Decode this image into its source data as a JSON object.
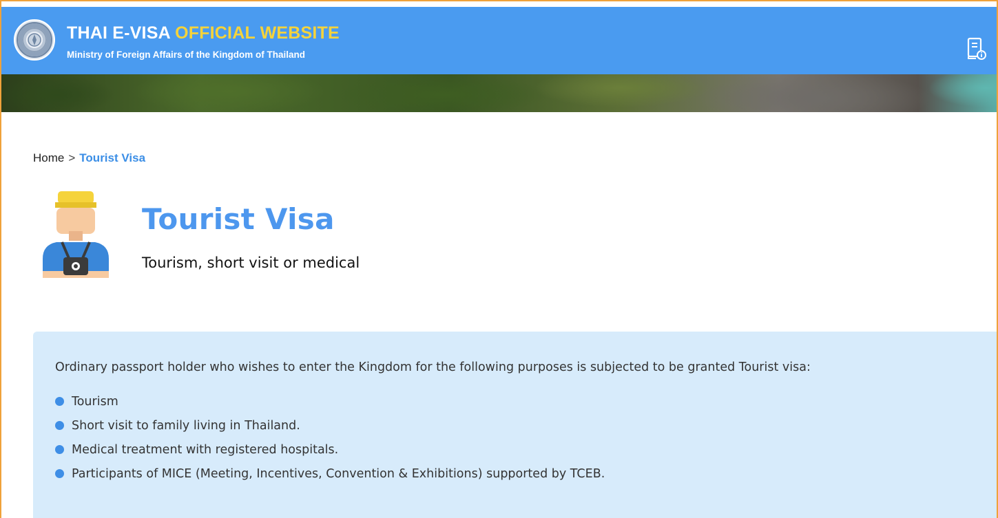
{
  "header": {
    "title_main": "THAI E-VISA",
    "title_accent": "OFFICIAL WEBSITE",
    "subtitle": "Ministry of Foreign Affairs of the Kingdom of Thailand",
    "brand_color": "#4a9bf0",
    "accent_color": "#f5d33b",
    "logo_icon": "government-seal-icon",
    "action_icon": "document-info-icon"
  },
  "breadcrumb": {
    "home": "Home",
    "separator": ">",
    "current": "Tourist Visa"
  },
  "page": {
    "icon": "tourist-avatar-icon",
    "title": "Tourist Visa",
    "subtitle": "Tourism, short visit or medical"
  },
  "info": {
    "intro": "Ordinary passport holder who wishes to enter the Kingdom for the following purposes is subjected to be granted Tourist visa:",
    "purposes": [
      "Tourism",
      "Short visit to family living in Thailand.",
      "Medical treatment with registered hospitals.",
      "Participants of MICE (Meeting, Incentives, Convention & Exhibitions) supported by TCEB."
    ]
  }
}
